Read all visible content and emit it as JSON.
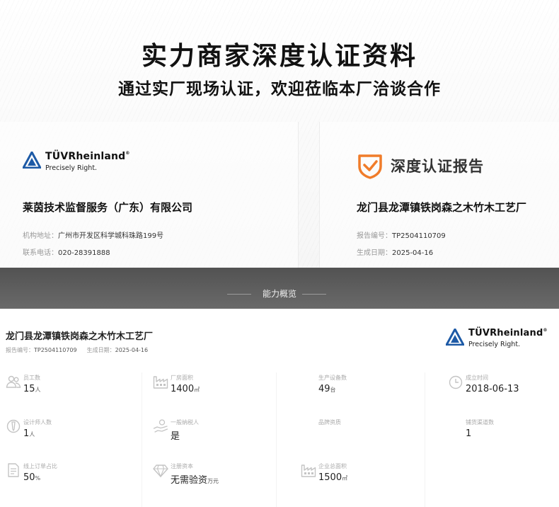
{
  "header": {
    "title": "实力商家深度认证资料",
    "subtitle": "通过实厂现场认证，欢迎莅临本厂洽谈合作"
  },
  "left_card": {
    "logo_brand": "TÜVRheinland",
    "logo_reg": "®",
    "logo_slogan": "Precisely Right.",
    "company": "莱茵技术监督服务（广东）有限公司",
    "address_label": "机构地址：",
    "address_value": "广州市开发区科学城科珠路199号",
    "phone_label": "联系电话：",
    "phone_value": "020-28391888"
  },
  "right_card": {
    "report_title": "深度认证报告",
    "company": "龙门县龙潭镇铁岗森之木竹木工艺厂",
    "report_no_label": "报告编号：",
    "report_no_value": "TP2504110709",
    "date_label": "生成日期：",
    "date_value": "2025-04-16"
  },
  "band": {
    "title": "能力概览"
  },
  "overview": {
    "company": "龙门县龙潭镇铁岗森之木竹木工艺厂",
    "report_no_label": "报告编号：",
    "report_no_value": "TP2504110709",
    "date_label": "生成日期：",
    "date_value": "2025-04-16",
    "logo_brand": "TÜVRheinland",
    "logo_reg": "®",
    "logo_slogan": "Precisely Right.",
    "items": [
      {
        "label": "员工数",
        "value": "15",
        "unit": "人",
        "icon": "people-icon"
      },
      {
        "label": "厂房面积",
        "value": "1400",
        "unit": "㎡",
        "icon": "factory-icon"
      },
      {
        "label": "生产设备数",
        "value": "49",
        "unit": "台",
        "icon": ""
      },
      {
        "label": "成立时间",
        "value": "2018-06-13",
        "unit": "",
        "icon": "clock-icon"
      },
      {
        "label": "设计师人数",
        "value": "1",
        "unit": "人",
        "icon": "designer-icon"
      },
      {
        "label": "一般纳税人",
        "value": "是",
        "unit": "",
        "icon": "hand-coin-icon"
      },
      {
        "label": "品牌资质",
        "value": "",
        "unit": "",
        "icon": ""
      },
      {
        "label": "铺货渠道数",
        "value": "1",
        "unit": "",
        "icon": ""
      },
      {
        "label": "线上订单占比",
        "value": "50",
        "unit": "%",
        "icon": "document-icon"
      },
      {
        "label": "注册资本",
        "value": "无需验资",
        "unit": "万元",
        "icon": "diamond-icon"
      },
      {
        "label": "企业总面积",
        "value": "1500",
        "unit": "㎡",
        "icon": "factory-icon"
      }
    ]
  },
  "colors": {
    "tuv_blue": "#1d5aa6",
    "report_orange": "#f07c2a",
    "band_gray": "#5c5c5c"
  }
}
